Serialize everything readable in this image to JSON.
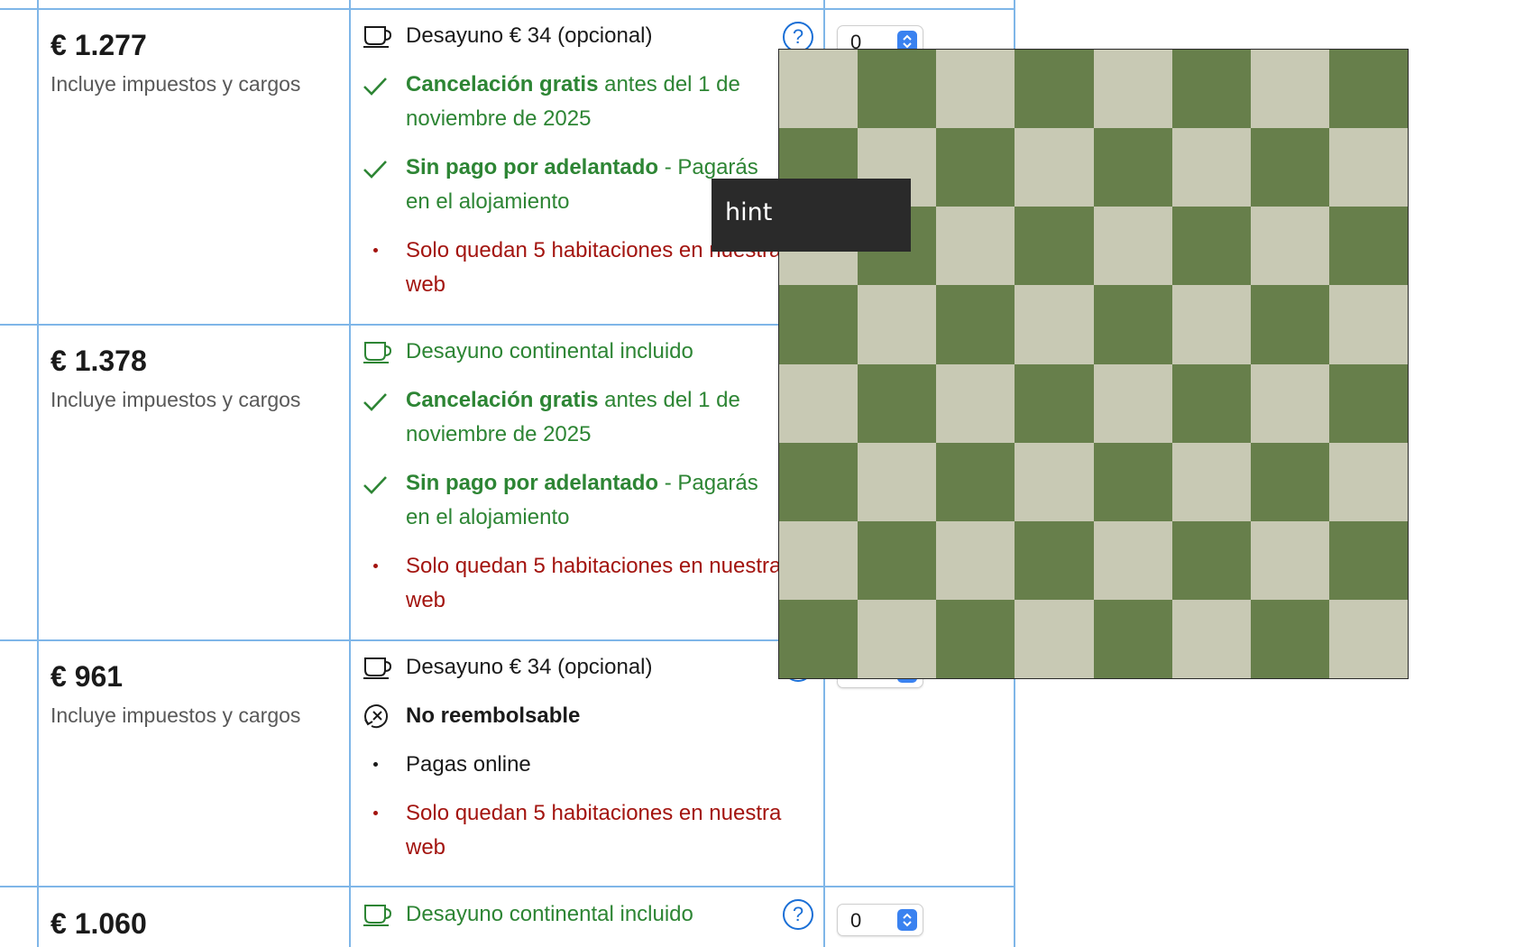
{
  "rows": [
    {
      "price": "€ 1.277",
      "taxes": "Incluye impuestos y cargos",
      "breakfast": "Desayuno € 34 (opcional)",
      "cancel_bold": "Cancelación gratis",
      "cancel_rest": " antes del 1 de noviembre de 2025",
      "prepay_bold": "Sin pago por adelantado",
      "prepay_rest": " - Pagarás en el alojamiento",
      "scarcity": "Solo quedan 5 habitaciones en nuestra web",
      "quantity": "0"
    },
    {
      "price": "€ 1.378",
      "taxes": "Incluye impuestos y cargos",
      "breakfast": "Desayuno continental incluido",
      "cancel_bold": "Cancelación gratis",
      "cancel_rest": " antes del 1 de noviembre de 2025",
      "prepay_bold": "Sin pago por adelantado",
      "prepay_rest": " - Pagarás en el alojamiento",
      "scarcity": "Solo quedan 5 habitaciones en nuestra web"
    },
    {
      "price": "€ 961",
      "taxes": "Incluye impuestos y cargos",
      "breakfast": "Desayuno € 34 (opcional)",
      "refund": "No reembolsable",
      "payment": "Pagas online",
      "scarcity": "Solo quedan 5 habitaciones en nuestra web",
      "quantity": "0"
    },
    {
      "price": "€ 1.060",
      "breakfast": "Desayuno continental incluido",
      "quantity": "0"
    }
  ],
  "help_symbol": "?",
  "tooltip": {
    "text": "hint"
  },
  "checkerboard": {
    "rows": 8,
    "cols": 8,
    "dark_color": "#677f4b",
    "light_color": "#c8c9b4"
  },
  "colors": {
    "green": "#2d8534",
    "red": "#a3140f",
    "border": "#7fb6e8",
    "accent": "#1a6fd6"
  },
  "icons": [
    "cup-icon",
    "check-icon",
    "bullet-icon",
    "no-refund-icon",
    "help-icon",
    "stepper-arrows-icon"
  ]
}
